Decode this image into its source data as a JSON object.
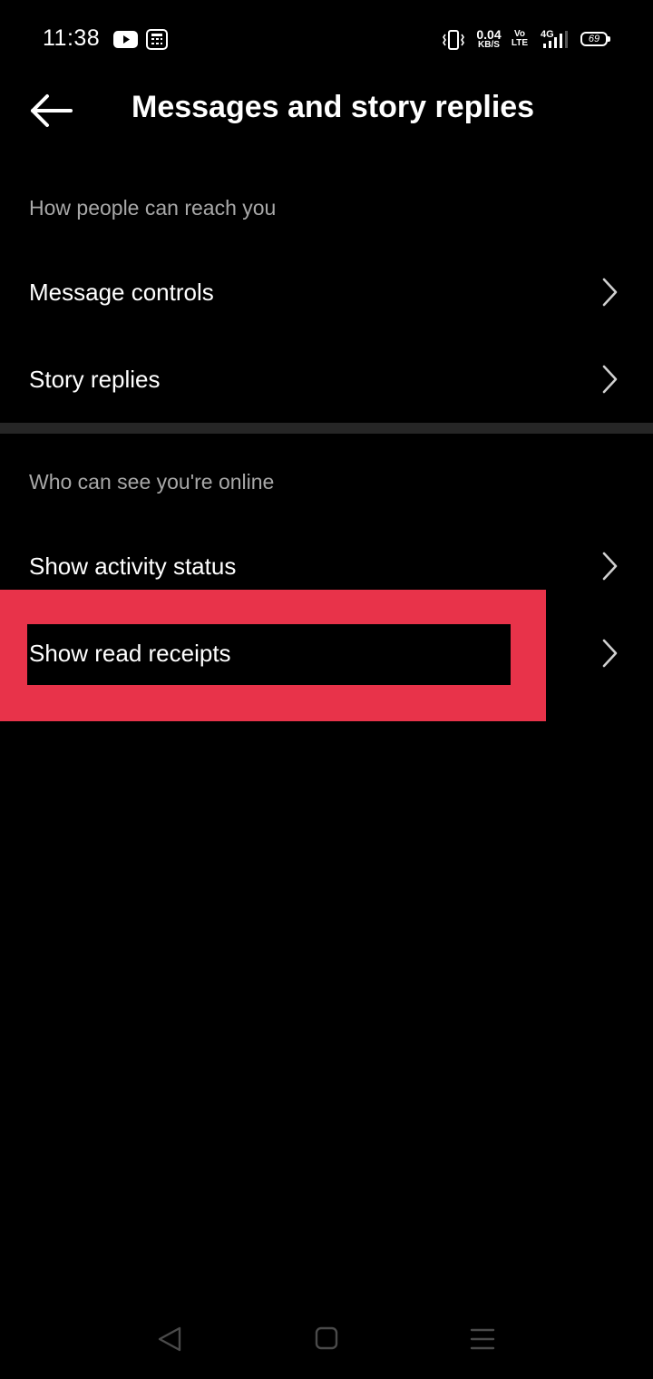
{
  "status_bar": {
    "time": "11:38",
    "net_speed_value": "0.04",
    "net_speed_unit": "KB/S",
    "volte_top": "Vo",
    "volte_bottom": "LTE",
    "network": "4G",
    "battery": "69",
    "notification_icons": [
      "youtube-icon",
      "calculator-icon"
    ],
    "status_icons": [
      "vibrate-icon",
      "signal-icon"
    ]
  },
  "header": {
    "title": "Messages and story replies",
    "back_icon": "arrow-left-icon"
  },
  "sections": [
    {
      "header": "How people can reach you",
      "items": [
        {
          "label": "Message controls"
        },
        {
          "label": "Story replies"
        }
      ]
    },
    {
      "header": "Who can see you're online",
      "items": [
        {
          "label": "Show activity status"
        },
        {
          "label": "Show read receipts"
        }
      ]
    }
  ],
  "highlight": {
    "color": "#e8334a",
    "target": "Show read receipts"
  },
  "nav_bar": {
    "icons": [
      "back-triangle-icon",
      "home-square-icon",
      "menu-lines-icon"
    ]
  },
  "colors": {
    "background": "#000000",
    "text_primary": "#ffffff",
    "text_secondary": "#a8a8a8",
    "divider": "#262626"
  }
}
